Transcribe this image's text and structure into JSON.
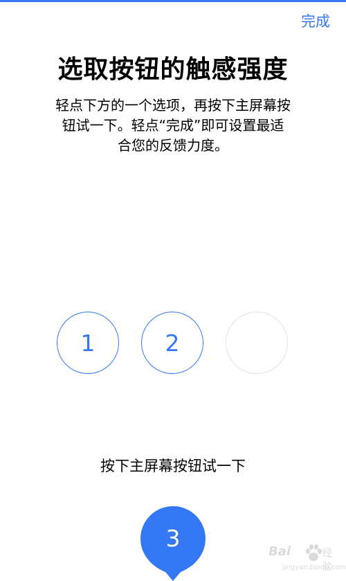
{
  "header": {
    "done_label": "完成"
  },
  "title": "选取按钮的触感强度",
  "description": {
    "lines": [
      "轻点下方的一个选项，再按下主屏幕按",
      "钮试一下。轻点“完成”即可设置最适",
      "合您的反馈力度。"
    ]
  },
  "options": [
    {
      "label": "1",
      "state": "outlined"
    },
    {
      "label": "2",
      "state": "outlined"
    },
    {
      "label": "",
      "state": "empty"
    }
  ],
  "instruction": "按下主屏幕按钮试一下",
  "selected_pin": {
    "label": "3"
  },
  "watermark": {
    "brand": "Bai",
    "brand_suffix": "经验",
    "domain": "jingyan.baidu.com"
  },
  "colors": {
    "accent": "#3478f6",
    "empty_border": "#e1e1e1"
  }
}
